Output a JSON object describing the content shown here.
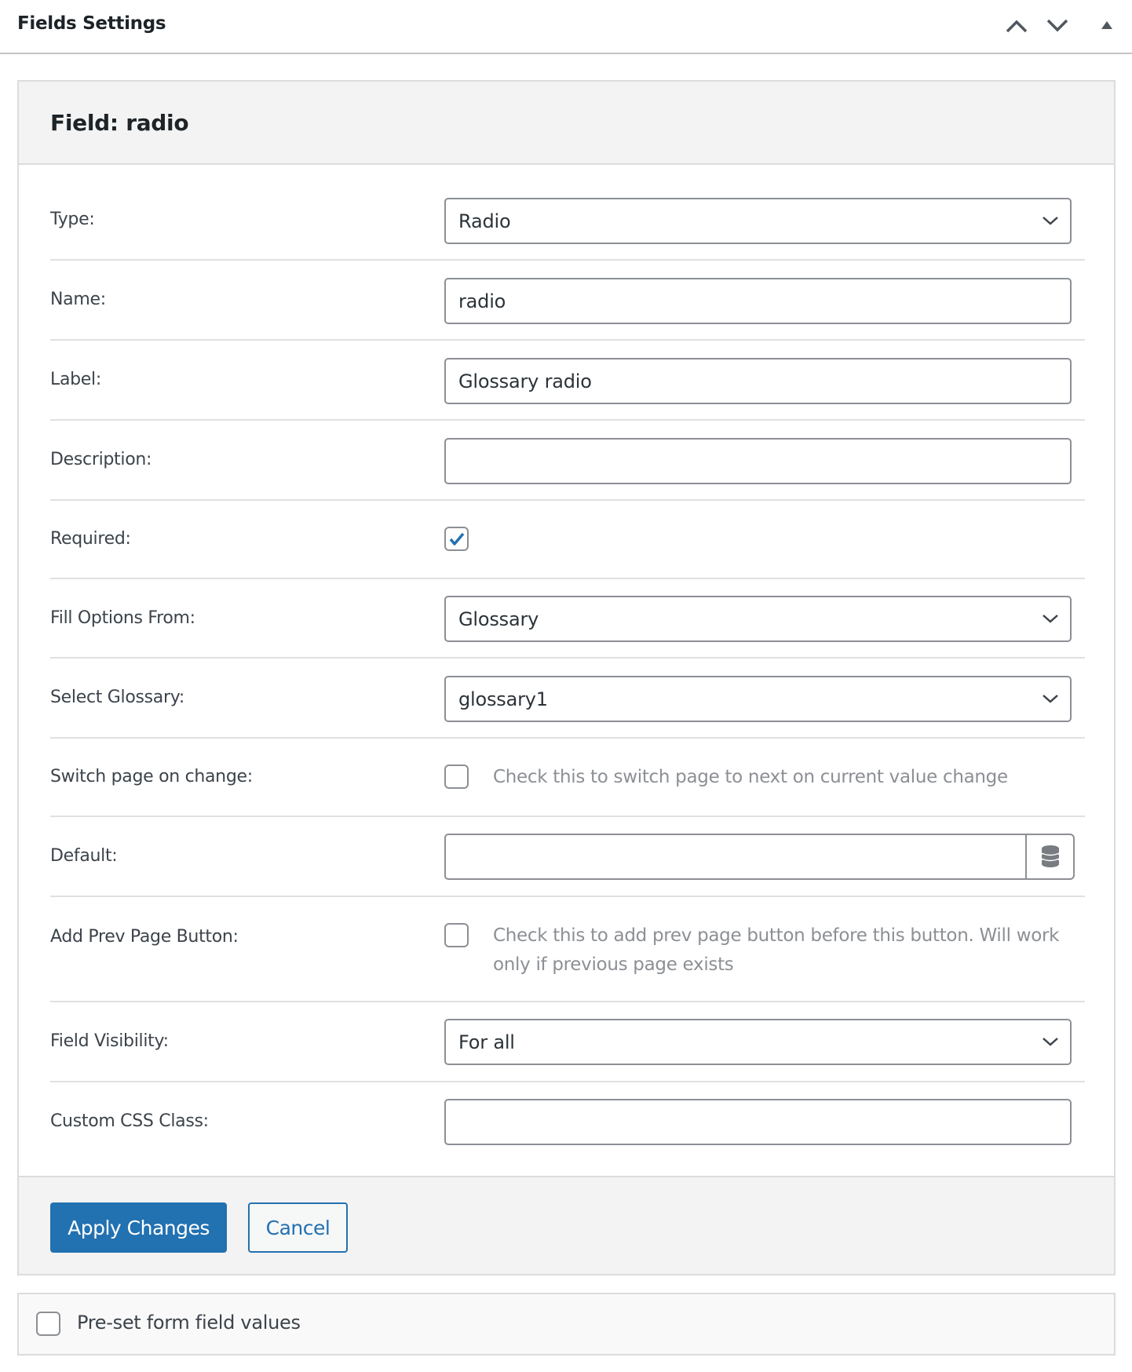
{
  "header": {
    "title": "Fields Settings",
    "controls": [
      {
        "name": "move-up",
        "icon": "chevron-up-icon"
      },
      {
        "name": "move-down",
        "icon": "chevron-down-icon"
      },
      {
        "name": "toggle-panel",
        "icon": "triangle-up-icon"
      }
    ]
  },
  "panel": {
    "title": "Field: radio",
    "fields": {
      "type": {
        "label": "Type:",
        "value": "Radio"
      },
      "name": {
        "label": "Name:",
        "value": "radio"
      },
      "label": {
        "label": "Label:",
        "value": "Glossary radio"
      },
      "description": {
        "label": "Description:",
        "value": ""
      },
      "required": {
        "label": "Required:",
        "checked": true
      },
      "fill_options_from": {
        "label": "Fill Options From:",
        "value": "Glossary"
      },
      "select_glossary": {
        "label": "Select Glossary:",
        "value": "glossary1"
      },
      "switch_page": {
        "label": "Switch page on change:",
        "checked": false,
        "hint": "Check this to switch page to next on current value change"
      },
      "default": {
        "label": "Default:",
        "value": "",
        "icon": "database-icon"
      },
      "add_prev_page": {
        "label": "Add Prev Page Button:",
        "checked": false,
        "hint": "Check this to add prev page button before this button. Will work only if previous page exists"
      },
      "field_visibility": {
        "label": "Field Visibility:",
        "value": "For all"
      },
      "custom_css_class": {
        "label": "Custom CSS Class:",
        "value": ""
      }
    },
    "buttons": {
      "apply": "Apply Changes",
      "cancel": "Cancel"
    }
  },
  "preset": {
    "label": "Pre-set form field values",
    "checked": false
  },
  "colors": {
    "primary": "#2271b1",
    "check": "#2271b1",
    "border": "#8c8f94"
  }
}
